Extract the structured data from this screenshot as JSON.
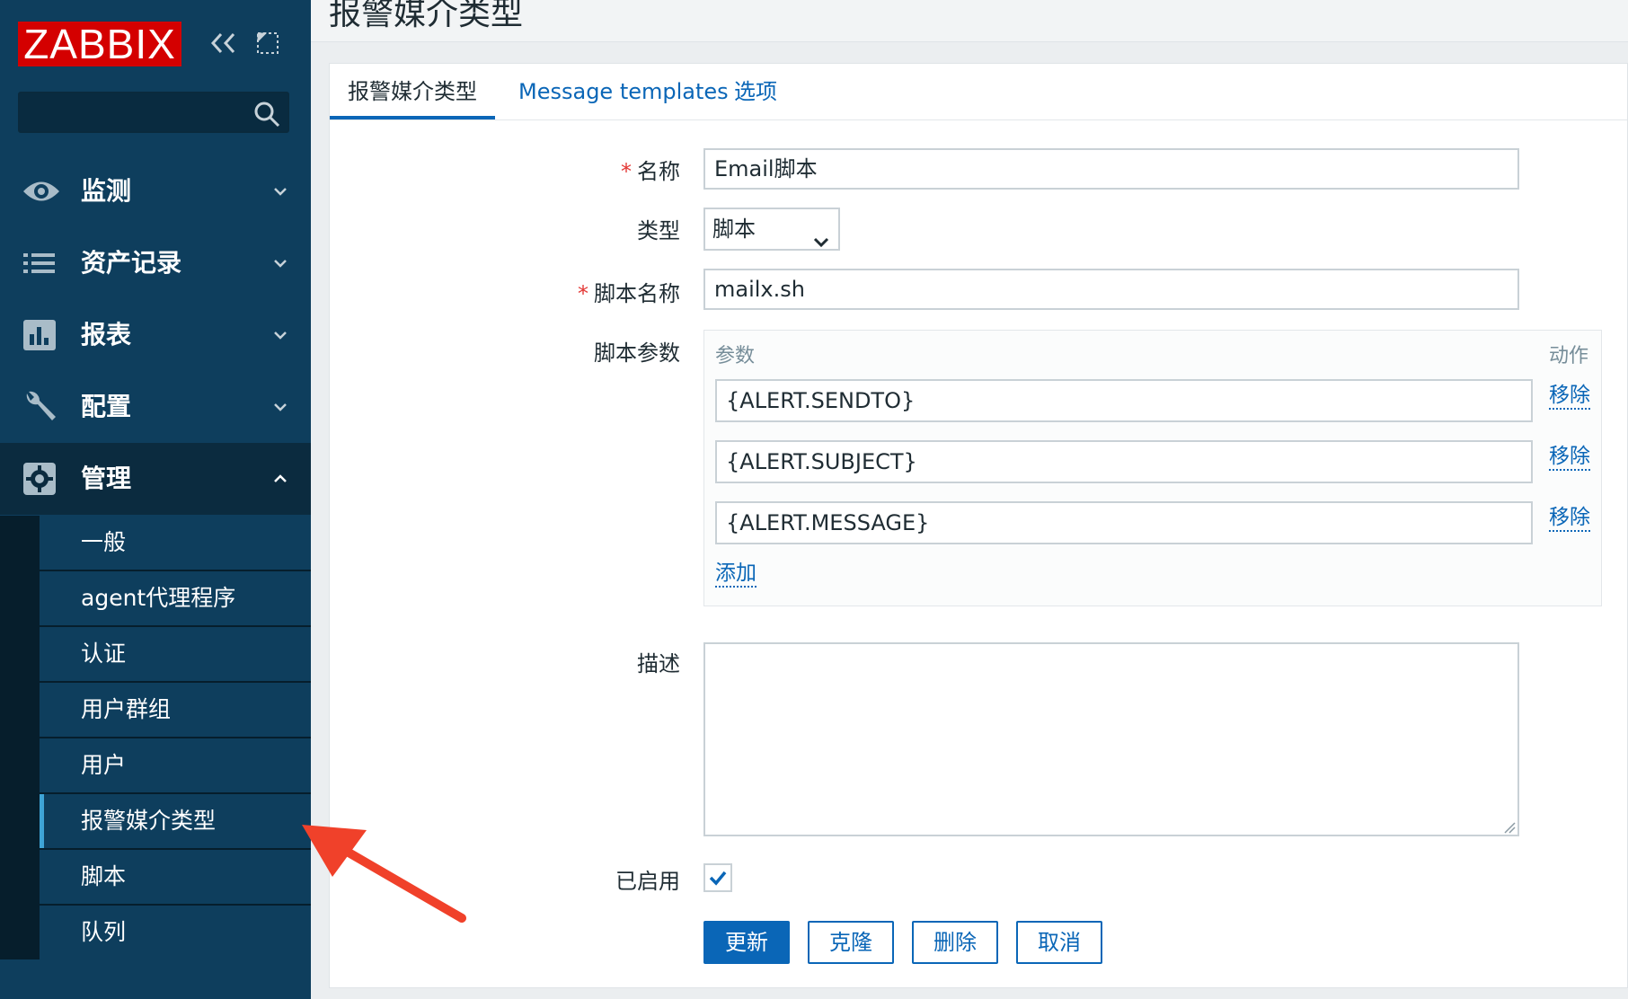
{
  "sidebar": {
    "logo": "ZABBIX",
    "menu": [
      {
        "label": "监测",
        "icon": "eye-icon"
      },
      {
        "label": "资产记录",
        "icon": "list-icon"
      },
      {
        "label": "报表",
        "icon": "bar-chart-icon"
      },
      {
        "label": "配置",
        "icon": "wrench-icon"
      },
      {
        "label": "管理",
        "icon": "gear-icon"
      }
    ],
    "submenu": [
      "一般",
      "agent代理程序",
      "认证",
      "用户群组",
      "用户",
      "报警媒介类型",
      "脚本",
      "队列"
    ],
    "selected_submenu": "报警媒介类型"
  },
  "page": {
    "title": "报警媒介类型"
  },
  "tabs": [
    "报警媒介类型",
    "Message templates",
    "选项"
  ],
  "form": {
    "name_label": "名称",
    "name_value": "Email脚本",
    "type_label": "类型",
    "type_value": "脚本",
    "script_name_label": "脚本名称",
    "script_name_value": "mailx.sh",
    "params_label": "脚本参数",
    "params_header": "参数",
    "actions_header": "动作",
    "params": [
      "{ALERT.SENDTO}",
      "{ALERT.SUBJECT}",
      "{ALERT.MESSAGE}"
    ],
    "remove_label": "移除",
    "add_label": "添加",
    "description_label": "描述",
    "description_value": "",
    "enabled_label": "已启用",
    "enabled": true
  },
  "buttons": {
    "update": "更新",
    "clone": "克隆",
    "delete": "删除",
    "cancel": "取消"
  },
  "colors": {
    "sidebar_bg": "#0e3e5d",
    "logo_bg": "#d40000",
    "accent": "#0a66b7",
    "annotation_arrow": "#f0412a"
  }
}
